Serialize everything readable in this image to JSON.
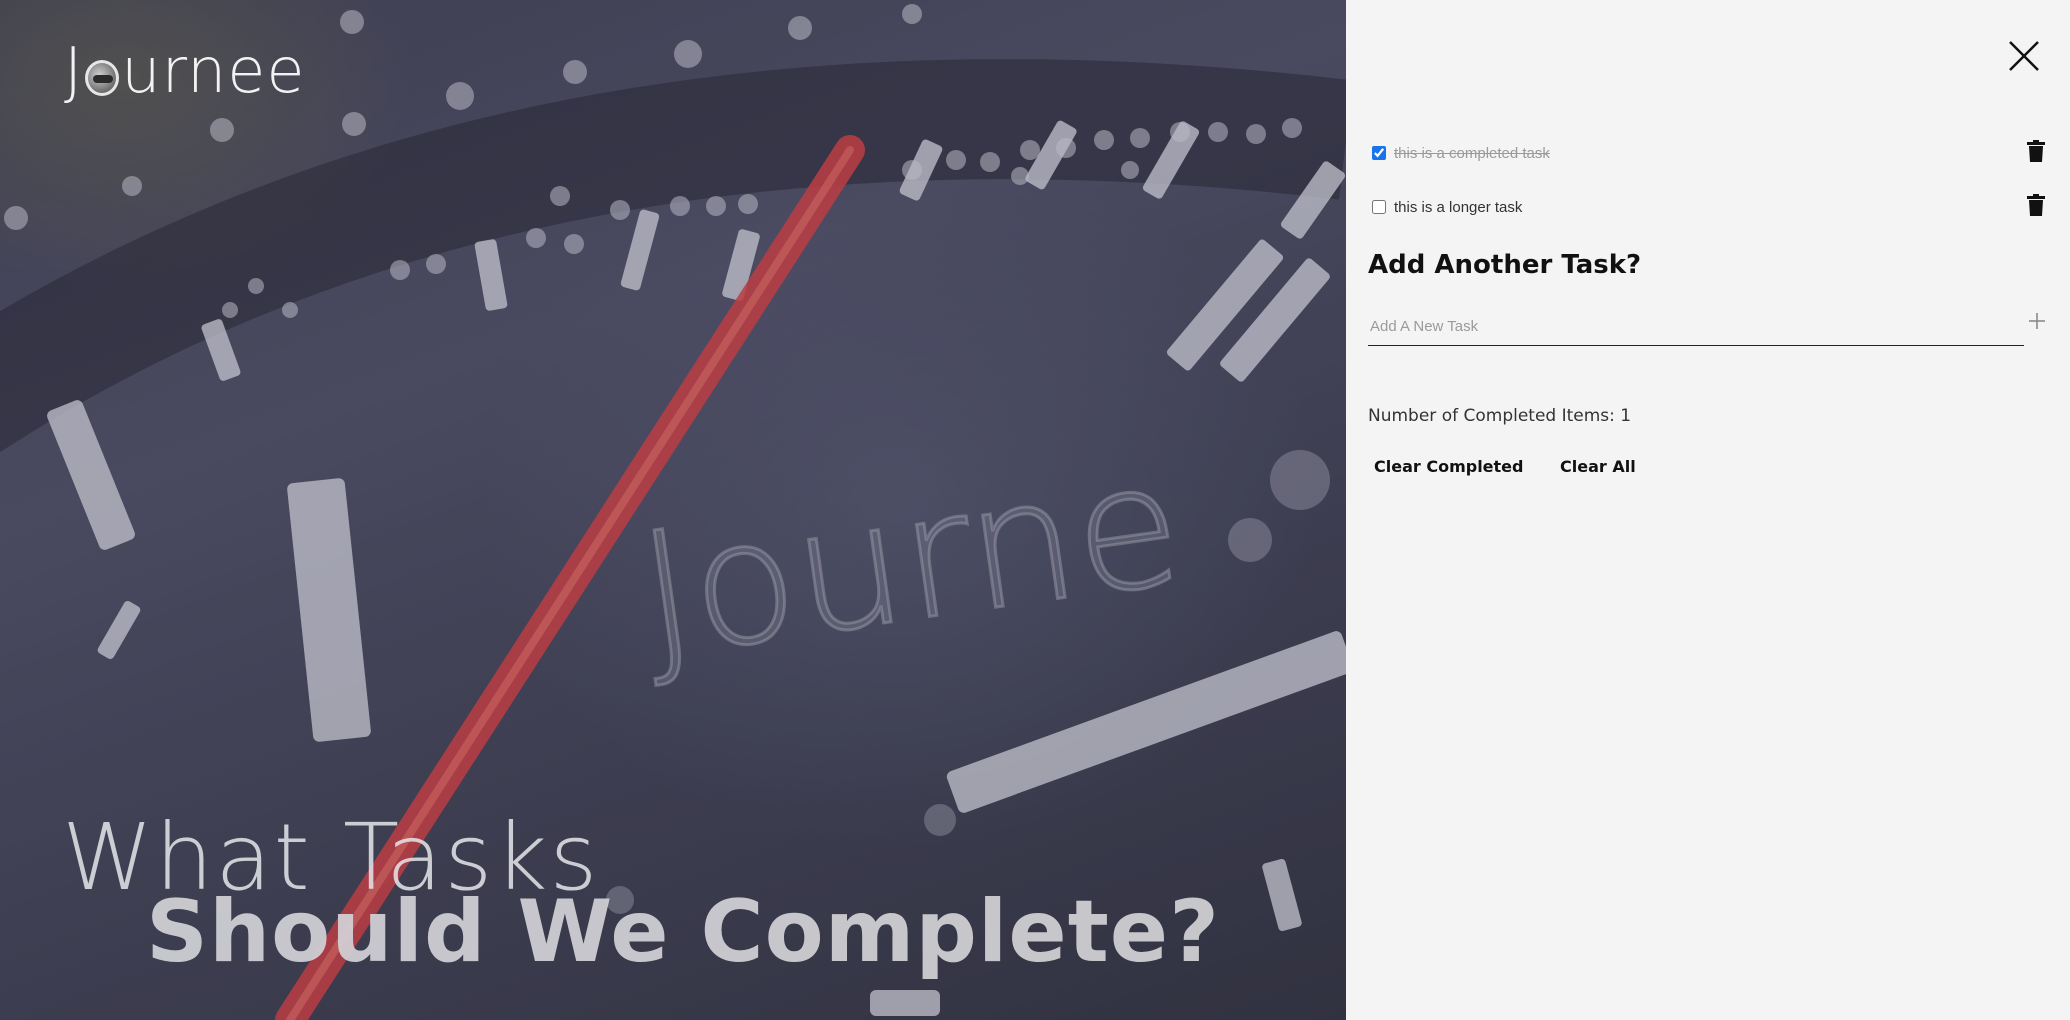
{
  "brand": {
    "logo_text": "Journee",
    "logo_prefix": "J",
    "logo_suffix": "urnee"
  },
  "hero": {
    "headline_light": "What Tasks",
    "headline_bold": "Should We Complete?"
  },
  "panel": {
    "close_icon": "close-icon",
    "tasks": [
      {
        "text": "this is a completed task",
        "completed": true
      },
      {
        "text": "this is a longer task",
        "completed": false
      }
    ],
    "add_heading": "Add Another Task?",
    "new_task_placeholder": "Add A New Task",
    "new_task_value": "",
    "completed_count_label": "Number of Completed Items: 1",
    "clear_completed_label": "Clear Completed",
    "clear_all_label": "Clear All"
  },
  "colors": {
    "panel_bg": "#f4f4f4",
    "accent_checkbox": "#1a73e8",
    "needle_red": "#e23a3a",
    "text_dark": "#111111"
  }
}
